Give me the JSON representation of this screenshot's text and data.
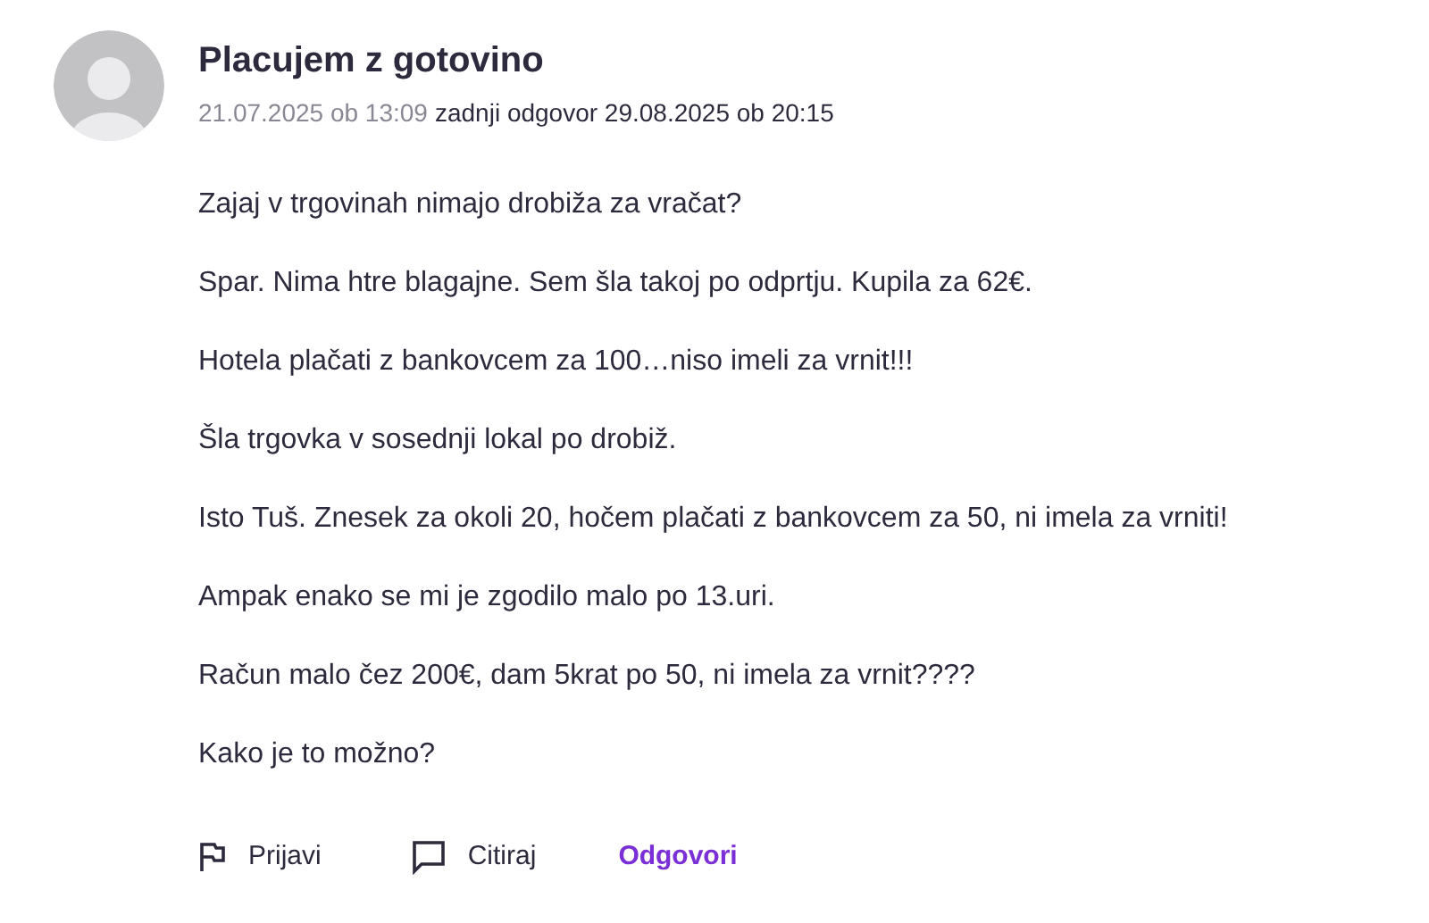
{
  "post": {
    "title": "Placujem z gotovino",
    "posted": "21.07.2025 ob 13:09",
    "last_reply": "zadnji odgovor 29.08.2025 ob 20:15",
    "paragraphs": [
      "Zajaj v trgovinah nimajo drobiža za vračat?",
      "Spar. Nima htre blagajne. Sem šla takoj po odprtju. Kupila za 62€.",
      "Hotela plačati z bankovcem za 100…niso imeli za vrnit!!!",
      "Šla trgovka v sosednji lokal po drobiž.",
      "Isto Tuš. Znesek za okoli 20, hočem plačati z bankovcem za 50, ni imela za vrniti!",
      "Ampak enako se mi je zgodilo malo po 13.uri.",
      "Račun malo čez 200€, dam 5krat po 50, ni imela za vrnit????",
      "Kako je to možno?"
    ]
  },
  "actions": [
    {
      "kind": "flag",
      "label": "Prijavi"
    },
    {
      "kind": "comment",
      "label": "Citiraj"
    },
    {
      "kind": "primary",
      "label": "Odgovori"
    }
  ]
}
